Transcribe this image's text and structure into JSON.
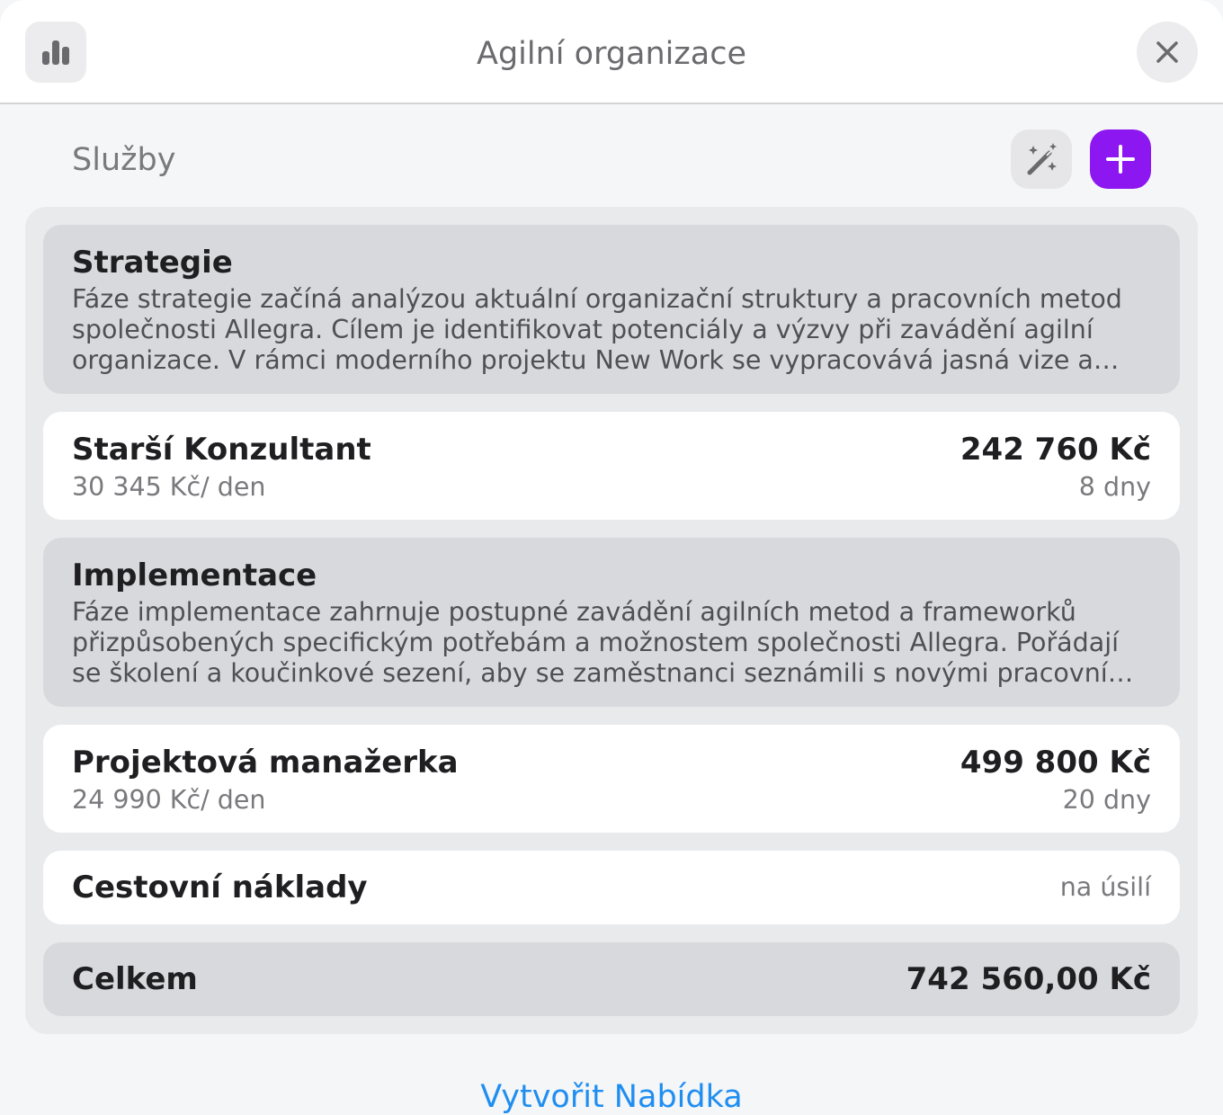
{
  "header": {
    "title": "Agilní organizace",
    "stats_icon": "bar-chart-icon",
    "close_icon": "close-icon"
  },
  "section": {
    "title": "Služby",
    "magic_icon": "magic-wand-icon",
    "add_icon": "plus-icon"
  },
  "phases": [
    {
      "title": "Strategie",
      "description": "Fáze strategie začíná analýzou aktuální organizační struktury a pracovních metod společnosti Allegra. Cílem je identifikovat potenciály a výzvy při zavádění agilní organizace. V rámci moderního projektu New Work se vypracovává jasná vize a cíle, …"
    },
    {
      "title": "Implementace",
      "description": "Fáze implementace zahrnuje postupné zavádění agilních metod a frameworků přizpůsobených specifickým potřebám a možnostem společnosti Allegra. Pořádají se školení a koučinkové sezení, aby se zaměstnanci seznámili s novými pracovními …"
    }
  ],
  "roles": [
    {
      "name": "Starší Konzultant",
      "rate": "30 345 Kč/ den",
      "amount": "242 760 Kč",
      "days": "8 dny"
    },
    {
      "name": "Projektová manažerka",
      "rate": "24 990 Kč/ den",
      "amount": "499 800 Kč",
      "days": "20 dny"
    }
  ],
  "travel": {
    "name": "Cestovní náklady",
    "note": "na úsilí"
  },
  "total": {
    "label": "Celkem",
    "amount": "742 560,00 Kč"
  },
  "footer": {
    "create_label": "Vytvořit Nabídka"
  },
  "colors": {
    "accent": "#8d17f0",
    "link": "#1f8ef1"
  }
}
